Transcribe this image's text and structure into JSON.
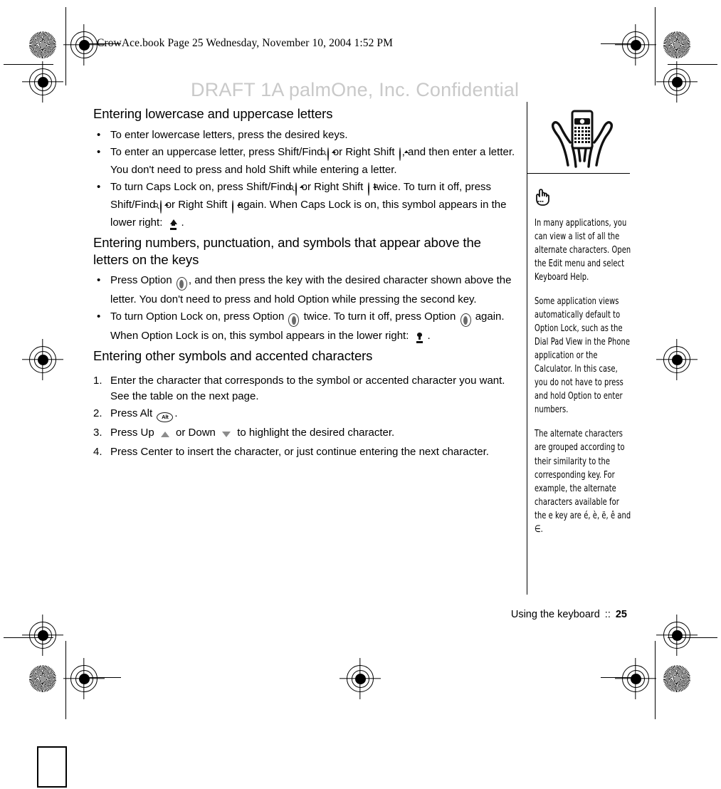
{
  "print_marks": {
    "file_stamp": "CrowAce.book  Page 25  Wednesday, November 10, 2004  1:52 PM",
    "watermark": "DRAFT 1A  palmOne, Inc.   Confidential"
  },
  "main": {
    "section1": {
      "heading": "Entering lowercase and uppercase letters",
      "bullet_char": "•",
      "bullets": [
        {
          "parts": [
            {
              "type": "text",
              "value": "To enter lowercase letters, press the desired keys."
            }
          ]
        },
        {
          "parts": [
            {
              "type": "text",
              "value": "To enter an uppercase letter, press Shift/Find "
            },
            {
              "type": "icon",
              "icon": "shift-find-key"
            },
            {
              "type": "text",
              "value": " or Right Shift "
            },
            {
              "type": "icon",
              "icon": "right-shift-key"
            },
            {
              "type": "text",
              "value": ", and then enter a letter. You don't need to press and hold Shift while entering a letter."
            }
          ]
        },
        {
          "parts": [
            {
              "type": "text",
              "value": "To turn Caps Lock on, press Shift/Find "
            },
            {
              "type": "icon",
              "icon": "shift-find-key"
            },
            {
              "type": "text",
              "value": " or Right Shift "
            },
            {
              "type": "icon",
              "icon": "right-shift-key"
            },
            {
              "type": "text",
              "value": " twice. To turn it off, press Shift/Find "
            },
            {
              "type": "icon",
              "icon": "shift-find-key"
            },
            {
              "type": "text",
              "value": " or Right Shift "
            },
            {
              "type": "icon",
              "icon": "right-shift-key"
            },
            {
              "type": "text",
              "value": " again. When Caps Lock is on, this symbol appears in the lower right: "
            },
            {
              "type": "icon",
              "icon": "caps-lock-symbol"
            },
            {
              "type": "text",
              "value": "."
            }
          ]
        }
      ]
    },
    "section2": {
      "heading": "Entering numbers, punctuation, and symbols that appear above the letters on the keys",
      "bullets": [
        {
          "parts": [
            {
              "type": "text",
              "value": "Press Option "
            },
            {
              "type": "icon",
              "icon": "option-key"
            },
            {
              "type": "text",
              "value": ", and then press the key with the desired character shown above the letter. You don't need to press and hold Option while pressing the second key."
            }
          ]
        },
        {
          "parts": [
            {
              "type": "text",
              "value": "To turn Option Lock on, press Option "
            },
            {
              "type": "icon",
              "icon": "option-key"
            },
            {
              "type": "text",
              "value": " twice. To turn it off, press Option "
            },
            {
              "type": "icon",
              "icon": "option-key"
            },
            {
              "type": "text",
              "value": " again. When Option Lock is on, this symbol appears in the lower right: "
            },
            {
              "type": "icon",
              "icon": "option-lock-symbol"
            },
            {
              "type": "text",
              "value": "."
            }
          ]
        }
      ]
    },
    "section3": {
      "heading": "Entering other symbols and accented characters",
      "steps": [
        {
          "number": "1.",
          "parts": [
            {
              "type": "text",
              "value": "Enter the character that corresponds to the symbol or accented character you want. See the table on the next page."
            }
          ]
        },
        {
          "number": "2.",
          "parts": [
            {
              "type": "text",
              "value": "Press Alt "
            },
            {
              "type": "icon",
              "icon": "alt-key"
            },
            {
              "type": "text",
              "value": "."
            }
          ]
        },
        {
          "number": "3.",
          "parts": [
            {
              "type": "text",
              "value": "Press Up "
            },
            {
              "type": "icon",
              "icon": "up-arrow"
            },
            {
              "type": "text",
              "value": " or Down "
            },
            {
              "type": "icon",
              "icon": "down-arrow"
            },
            {
              "type": "text",
              "value": " to highlight the desired character."
            }
          ]
        },
        {
          "number": "4.",
          "parts": [
            {
              "type": "text",
              "value": "Press Center to insert the character, or just continue entering the next character."
            }
          ]
        }
      ]
    }
  },
  "sidebar": {
    "illustration_name": "hands-holding-smartphone-illustration",
    "tip_icon_name": "pointing-hand-icon",
    "tips": [
      "In many applications, you can view a list of all the alternate characters. Open the Edit menu and select Keyboard Help.",
      "Some application views automatically default to Option Lock, such as the Dial Pad View in the Phone application or the Calculator. In this case, you do not have to press and hold Option to enter numbers.",
      "The alternate characters are grouped according to their similarity to the corresponding key. For example, the alternate characters available for the e key are é, è, ë, ê and ∈."
    ]
  },
  "footer": {
    "chapter": "Using the keyboard",
    "separator": "::",
    "page_number": "25"
  },
  "colors": {
    "ink": "#000000",
    "watermark_gray": "#c9c9c9",
    "arrow_gray": "#8c8c8c"
  }
}
